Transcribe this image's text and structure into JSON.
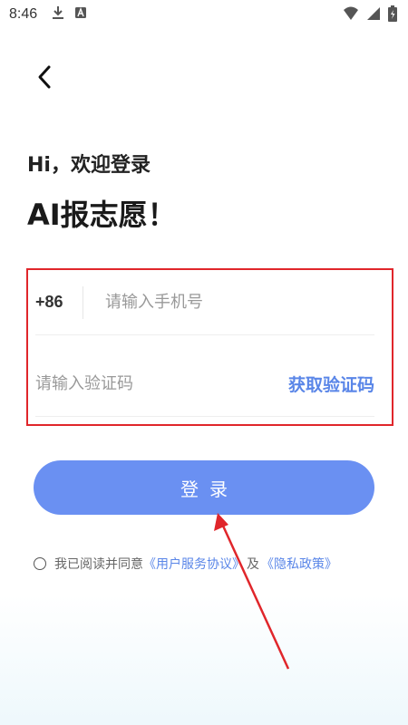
{
  "status_bar": {
    "time": "8:46",
    "icons_left": [
      "download-icon",
      "a-letter-icon"
    ],
    "icons_right": [
      "wifi-icon",
      "signal-icon",
      "battery-icon"
    ]
  },
  "nav": {
    "back_icon": "back-chevron-icon"
  },
  "header": {
    "greeting": "Hi，欢迎登录",
    "title": "AI报志愿！"
  },
  "form": {
    "country_code": "+86",
    "phone_placeholder": "请输入手机号",
    "code_placeholder": "请输入验证码",
    "get_code_label": "获取验证码"
  },
  "login_button": {
    "label": "登录"
  },
  "agreement": {
    "prefix": "我已阅读并同意",
    "user_agreement": "《用户服务协议》",
    "conjunction": "及",
    "privacy_policy": "《隐私政策》",
    "checked": false
  },
  "colors": {
    "accent": "#6a90f2",
    "link": "#5a86e8",
    "highlight_box": "#e0262b",
    "annotation_arrow": "#e0262b"
  }
}
